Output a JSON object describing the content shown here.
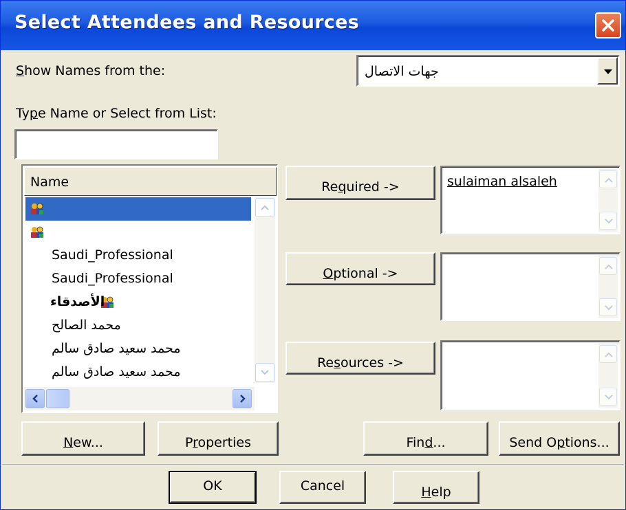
{
  "window": {
    "title": "Select Attendees and Resources"
  },
  "show_names": {
    "label_prefix": "S",
    "label_rest": "how Names from the:",
    "selected": "جهات الاتصال"
  },
  "type_name": {
    "label_prefix": "Ty",
    "label_mn": "p",
    "label_rest": "e Name or Select from List:",
    "value": ""
  },
  "name_list": {
    "header": "Name",
    "items": [
      {
        "label": "",
        "icon": "distribution-list-icon",
        "selected": true
      },
      {
        "label": "",
        "icon": "distribution-list-icon",
        "selected": false
      },
      {
        "label": "Saudi_Professional",
        "icon": "",
        "selected": false
      },
      {
        "label": "Saudi_Professional",
        "icon": "",
        "selected": false
      },
      {
        "label": "الأصدقاء",
        "icon": "distribution-list-icon",
        "selected": false
      },
      {
        "label": "محمد الصالح",
        "icon": "",
        "selected": false
      },
      {
        "label": "محمد سعيد صادق سالم",
        "icon": "",
        "selected": false
      },
      {
        "label": "محمد سعيد صادق سالم",
        "icon": "",
        "selected": false
      }
    ]
  },
  "buttons": {
    "required": {
      "pre": "Re",
      "mn": "q",
      "post": "uired ->"
    },
    "optional": {
      "pre": "",
      "mn": "O",
      "post": "ptional ->"
    },
    "resources": {
      "pre": "Re",
      "mn": "s",
      "post": "ources ->"
    },
    "new": {
      "pre": "",
      "mn": "N",
      "post": "ew..."
    },
    "properties": {
      "pre": "P",
      "mn": "r",
      "post": "operties"
    },
    "find": {
      "pre": "Fin",
      "mn": "d",
      "post": "..."
    },
    "send_options": {
      "pre": "Send O",
      "mn": "p",
      "post": "tions..."
    },
    "ok": "OK",
    "cancel": "Cancel",
    "help": {
      "pre": "",
      "mn": "H",
      "post": "elp"
    }
  },
  "recipients": {
    "required": [
      "sulaiman alsaleh"
    ],
    "optional": [],
    "resources": []
  },
  "colors": {
    "title_blue": "#0b47d6",
    "selection": "#316ac5",
    "dialog_bg": "#ece9d8",
    "close_red": "#d9441e"
  }
}
